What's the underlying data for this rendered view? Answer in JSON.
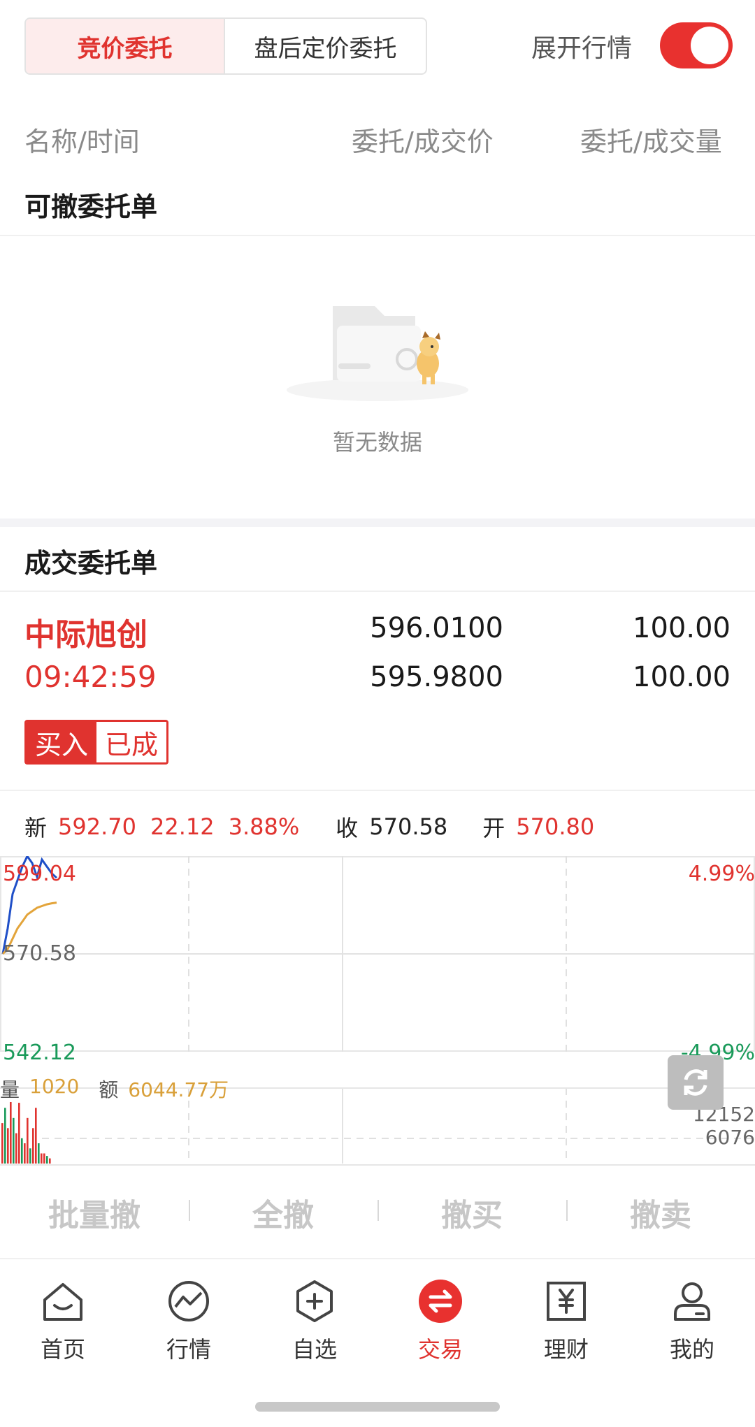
{
  "tabs": {
    "active": "竞价委托",
    "inactive": "盘后定价委托"
  },
  "expand_quote": {
    "label": "展开行情",
    "on": true
  },
  "columns": {
    "name_time": "名称/时间",
    "price": "委托/成交价",
    "qty": "委托/成交量"
  },
  "cancelable": {
    "title": "可撤委托单",
    "empty_text": "暂无数据"
  },
  "filled": {
    "title": "成交委托单",
    "order": {
      "name": "中际旭创",
      "time": "09:42:59",
      "order_price": "596.0100",
      "deal_price": "595.9800",
      "order_qty": "100.00",
      "deal_qty": "100.00",
      "side": "买入",
      "status": "已成"
    }
  },
  "quote": {
    "new_label": "新",
    "new_price": "592.70",
    "change": "22.12",
    "change_pct": "3.88%",
    "close_label": "收",
    "close_price": "570.58",
    "open_label": "开",
    "open_price": "570.80"
  },
  "chart": {
    "high_label": "599.04",
    "base_label": "570.58",
    "low_label": "542.12",
    "up_pct": "4.99%",
    "down_pct": "-4.99%",
    "vol_label": "量",
    "vol_value": "1020",
    "amount_label": "额",
    "amount_value": "6044.77万",
    "vol_max": "12152",
    "vol_mid": "6076"
  },
  "chart_data": {
    "type": "line",
    "ylim": [
      542.12,
      599.04
    ],
    "series": [
      {
        "values": [
          570.6,
          578,
          588,
          592,
          596,
          599,
          597,
          593,
          598,
          596,
          594,
          592.7
        ]
      },
      {
        "values": [
          570.6,
          572,
          575,
          578,
          580,
          582,
          583,
          584,
          584.5,
          585,
          585.3,
          585.5
        ]
      }
    ],
    "volumes": [
      8000,
      11000,
      7000,
      12152,
      9000,
      6000,
      12000,
      5000,
      4000,
      9000,
      3000,
      7000,
      11000,
      4000,
      2000,
      2000,
      1500,
      1020
    ]
  },
  "actions": [
    "批量撤",
    "全撤",
    "撤买",
    "撤卖"
  ],
  "nav": [
    {
      "label": "首页",
      "icon": "home-icon"
    },
    {
      "label": "行情",
      "icon": "market-icon"
    },
    {
      "label": "自选",
      "icon": "favorites-icon"
    },
    {
      "label": "交易",
      "icon": "trade-icon"
    },
    {
      "label": "理财",
      "icon": "finance-icon"
    },
    {
      "label": "我的",
      "icon": "profile-icon"
    }
  ],
  "colors": {
    "accent": "#e0332f",
    "green": "#1a9a5a",
    "amber": "#d9a03a"
  }
}
